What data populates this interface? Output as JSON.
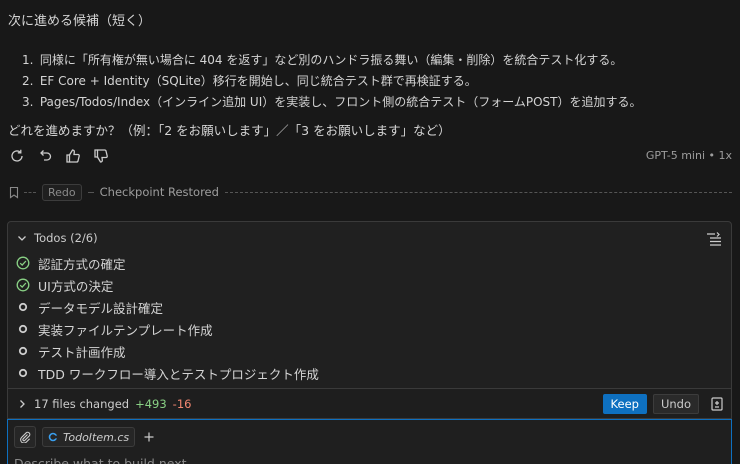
{
  "message": {
    "heading": "次に進める候補（短く）",
    "suggestions": [
      {
        "num": "1.",
        "text": "同様に「所有権が無い場合に 404 を返す」など別のハンドラ振る舞い（編集・削除）を統合テスト化する。"
      },
      {
        "num": "2.",
        "text": "EF Core + Identity（SQLite）移行を開始し、同じ統合テスト群で再検証する。"
      },
      {
        "num": "3.",
        "text": "Pages/Todos/Index（インライン追加 UI）を実装し、フロント側の統合テスト（フォームPOST）を追加する。"
      }
    ],
    "question": "どれを進めますか？（例：「2 をお願いします」／「3 をお願いします」など）",
    "model_info": "GPT-5 mini • 1x"
  },
  "checkpoint": {
    "redo_label": "Redo",
    "status": "Checkpoint Restored"
  },
  "todos": {
    "header": "Todos (2/6)",
    "items": [
      {
        "label": "認証方式の確定",
        "status": "done"
      },
      {
        "label": "UI方式の決定",
        "status": "done"
      },
      {
        "label": "データモデル設計確定",
        "status": "pending"
      },
      {
        "label": "実装ファイルテンプレート作成",
        "status": "pending"
      },
      {
        "label": "テスト計画作成",
        "status": "pending"
      },
      {
        "label": "TDD ワークフロー導入とテストプロジェクト作成",
        "status": "pending"
      }
    ]
  },
  "changes": {
    "summary": "17 files changed",
    "added": "+493",
    "removed": "-16",
    "keep_label": "Keep",
    "undo_label": "Undo"
  },
  "composer": {
    "chip_label": "TodoItem.cs",
    "placeholder": "Describe what to build next"
  },
  "colors": {
    "accent": "#0e70c0",
    "success": "#89d185",
    "danger": "#f48771"
  }
}
